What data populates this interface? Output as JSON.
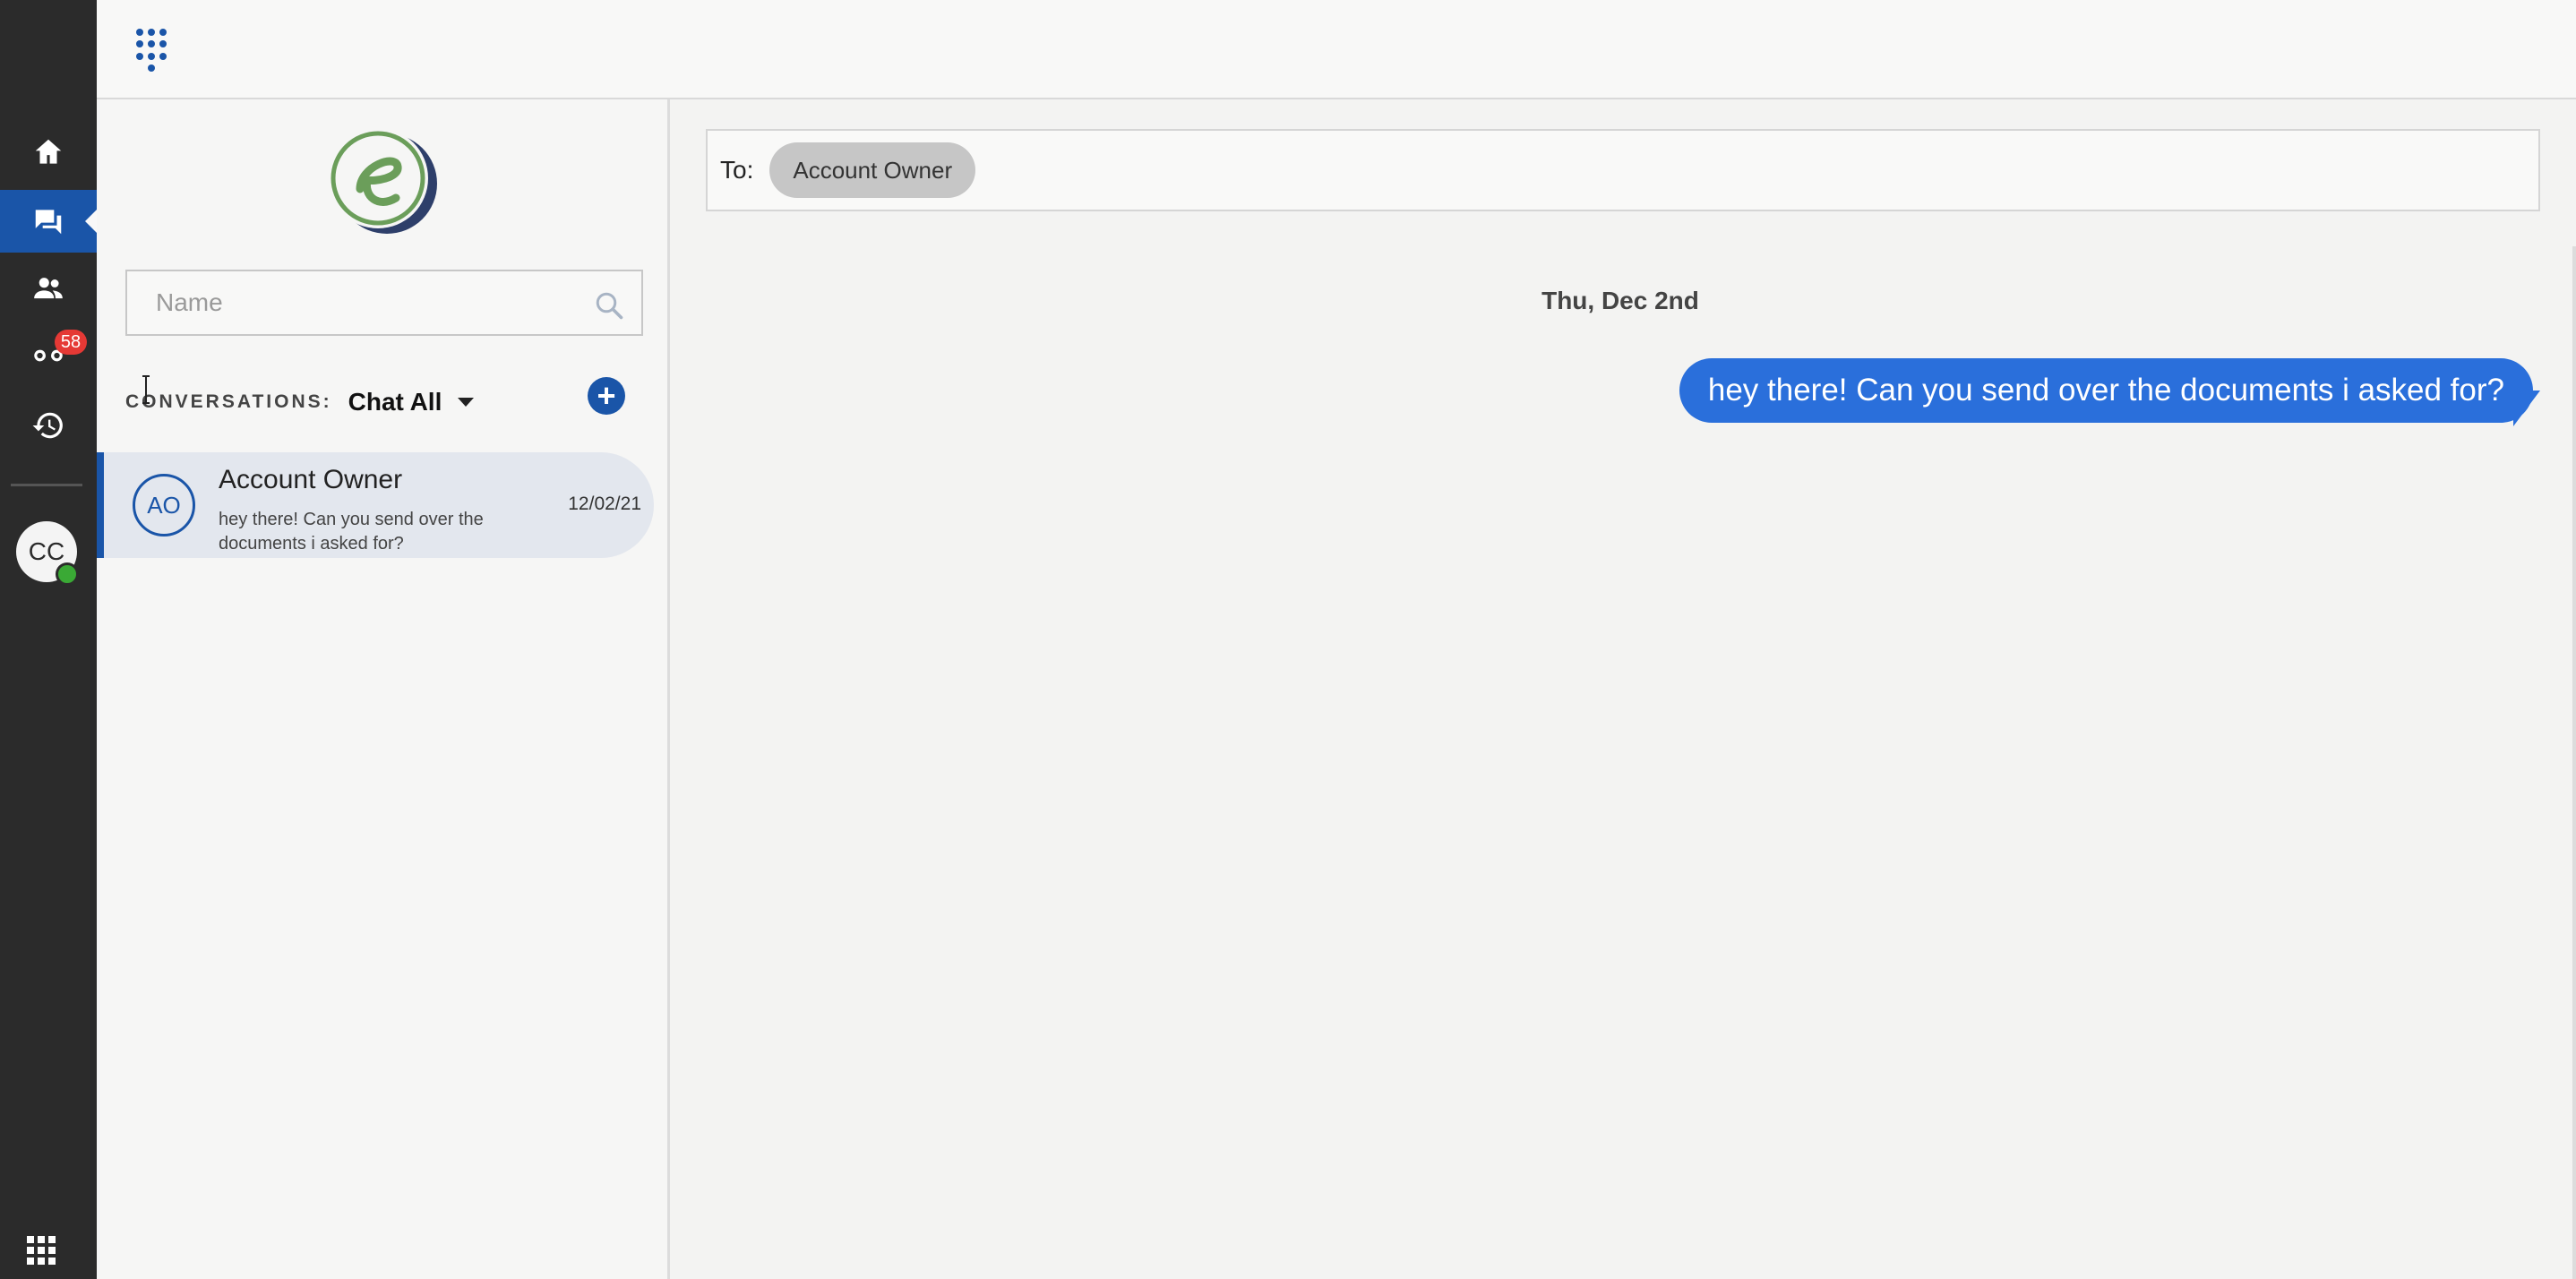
{
  "rail": {
    "voicemail_badge": "58",
    "user_initials": "CC",
    "items": [
      {
        "name": "home-icon"
      },
      {
        "name": "chat-icon",
        "active": true
      },
      {
        "name": "contacts-icon"
      },
      {
        "name": "voicemail-icon"
      },
      {
        "name": "history-icon"
      }
    ],
    "presence_color": "#3aa935"
  },
  "search": {
    "placeholder": "Name",
    "value": ""
  },
  "conversations": {
    "label": "CONVERSATIONS:",
    "filter": "Chat All",
    "items": [
      {
        "initials": "AO",
        "name": "Account Owner",
        "preview": "hey there! Can you send over the documents i asked for?",
        "date": "12/02/21"
      }
    ]
  },
  "composer": {
    "to_label": "To:",
    "recipient": "Account Owner"
  },
  "thread": {
    "date_divider": "Thu, Dec 2nd",
    "messages": [
      {
        "text": "hey there! Can you send over the documents i asked for?",
        "outgoing": true
      }
    ]
  },
  "colors": {
    "accent": "#1a55a8",
    "bubble": "#2a6fdb",
    "rail_bg": "#2b2b2b",
    "badge": "#e53935"
  }
}
